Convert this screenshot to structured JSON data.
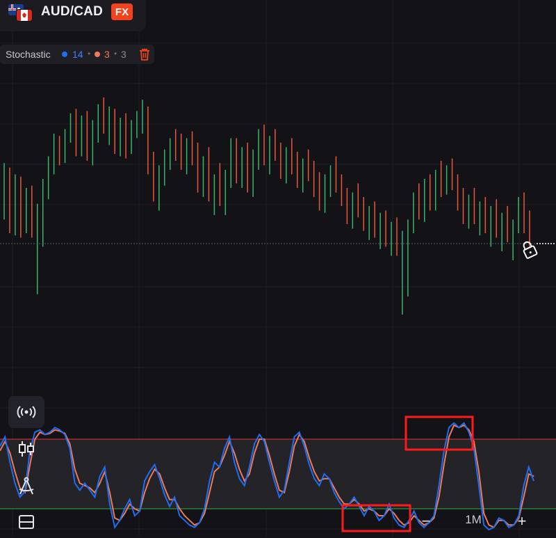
{
  "header": {
    "pair": "AUD/CAD",
    "badge": "FX"
  },
  "indicator": {
    "name": "Stochastic",
    "k_period": "14",
    "k_smoothing": "3",
    "d_period": "3",
    "k_color": "#1d6ef5",
    "d_color": "#f07a55"
  },
  "zoom": {
    "minus": "−",
    "level": "1M",
    "plus": "+"
  },
  "sidebar": {
    "icons": [
      "broadcast-icon",
      "candles-icon",
      "drawing-compass-icon",
      "layout-split-icon"
    ]
  },
  "colors": {
    "background": "#131317",
    "bull": "#3bb46c",
    "bear": "#e8573a",
    "overbought_line": "#e23a3a",
    "oversold_line": "#2bb24c",
    "highlight_box": "#ff1a1a"
  },
  "chart_data": {
    "type": "candlestick",
    "candles": [
      [
        0.52,
        0.71,
        0.46,
        0.63
      ],
      [
        0.63,
        0.69,
        0.4,
        0.46
      ],
      [
        0.46,
        0.66,
        0.39,
        0.6
      ],
      [
        0.6,
        0.65,
        0.38,
        0.49
      ],
      [
        0.49,
        0.6,
        0.4,
        0.55
      ],
      [
        0.55,
        0.61,
        0.38,
        0.41
      ],
      [
        0.41,
        0.53,
        0.13,
        0.48
      ],
      [
        0.48,
        0.64,
        0.34,
        0.58
      ],
      [
        0.58,
        0.74,
        0.55,
        0.72
      ],
      [
        0.72,
        0.84,
        0.66,
        0.8
      ],
      [
        0.8,
        0.83,
        0.7,
        0.74
      ],
      [
        0.74,
        0.86,
        0.71,
        0.83
      ],
      [
        0.83,
        0.93,
        0.8,
        0.9
      ],
      [
        0.9,
        0.95,
        0.74,
        0.77
      ],
      [
        0.77,
        0.92,
        0.74,
        0.89
      ],
      [
        0.89,
        0.94,
        0.72,
        0.76
      ],
      [
        0.76,
        0.9,
        0.7,
        0.86
      ],
      [
        0.86,
        0.97,
        0.8,
        0.94
      ],
      [
        0.94,
        1.0,
        0.84,
        0.87
      ],
      [
        0.87,
        0.96,
        0.79,
        0.92
      ],
      [
        0.92,
        0.95,
        0.75,
        0.8
      ],
      [
        0.8,
        0.91,
        0.74,
        0.88
      ],
      [
        0.88,
        0.93,
        0.73,
        0.78
      ],
      [
        0.78,
        0.9,
        0.75,
        0.86
      ],
      [
        0.86,
        0.94,
        0.82,
        0.9
      ],
      [
        0.9,
        0.99,
        0.84,
        0.93
      ],
      [
        0.93,
        0.96,
        0.66,
        0.69
      ],
      [
        0.69,
        0.76,
        0.54,
        0.58
      ],
      [
        0.58,
        0.7,
        0.5,
        0.66
      ],
      [
        0.66,
        0.77,
        0.61,
        0.73
      ],
      [
        0.73,
        0.82,
        0.68,
        0.79
      ],
      [
        0.79,
        0.86,
        0.72,
        0.76
      ],
      [
        0.76,
        0.84,
        0.68,
        0.7
      ],
      [
        0.7,
        0.82,
        0.66,
        0.78
      ],
      [
        0.78,
        0.85,
        0.7,
        0.74
      ],
      [
        0.74,
        0.8,
        0.58,
        0.62
      ],
      [
        0.62,
        0.74,
        0.56,
        0.7
      ],
      [
        0.7,
        0.78,
        0.54,
        0.58
      ],
      [
        0.58,
        0.66,
        0.48,
        0.62
      ],
      [
        0.62,
        0.71,
        0.52,
        0.55
      ],
      [
        0.55,
        0.68,
        0.48,
        0.64
      ],
      [
        0.64,
        0.82,
        0.6,
        0.79
      ],
      [
        0.79,
        0.82,
        0.62,
        0.66
      ],
      [
        0.66,
        0.78,
        0.6,
        0.74
      ],
      [
        0.74,
        0.8,
        0.58,
        0.62
      ],
      [
        0.62,
        0.77,
        0.56,
        0.72
      ],
      [
        0.72,
        0.86,
        0.68,
        0.82
      ],
      [
        0.82,
        0.88,
        0.7,
        0.74
      ],
      [
        0.74,
        0.83,
        0.66,
        0.79
      ],
      [
        0.79,
        0.86,
        0.72,
        0.76
      ],
      [
        0.76,
        0.8,
        0.64,
        0.68
      ],
      [
        0.68,
        0.78,
        0.62,
        0.74
      ],
      [
        0.74,
        0.82,
        0.66,
        0.7
      ],
      [
        0.7,
        0.76,
        0.6,
        0.64
      ],
      [
        0.64,
        0.73,
        0.58,
        0.7
      ],
      [
        0.7,
        0.77,
        0.63,
        0.66
      ],
      [
        0.66,
        0.72,
        0.56,
        0.6
      ],
      [
        0.6,
        0.67,
        0.5,
        0.56
      ],
      [
        0.56,
        0.66,
        0.49,
        0.62
      ],
      [
        0.62,
        0.7,
        0.56,
        0.66
      ],
      [
        0.66,
        0.74,
        0.58,
        0.6
      ],
      [
        0.6,
        0.66,
        0.52,
        0.55
      ],
      [
        0.55,
        0.6,
        0.44,
        0.5
      ],
      [
        0.5,
        0.58,
        0.42,
        0.54
      ],
      [
        0.54,
        0.62,
        0.47,
        0.5
      ],
      [
        0.5,
        0.56,
        0.41,
        0.45
      ],
      [
        0.45,
        0.52,
        0.37,
        0.48
      ],
      [
        0.48,
        0.54,
        0.38,
        0.42
      ],
      [
        0.42,
        0.49,
        0.33,
        0.46
      ],
      [
        0.46,
        0.5,
        0.34,
        0.38
      ],
      [
        0.38,
        0.45,
        0.3,
        0.42
      ],
      [
        0.42,
        0.47,
        0.3,
        0.35
      ],
      [
        0.35,
        0.41,
        0.04,
        0.38
      ],
      [
        0.38,
        0.46,
        0.12,
        0.43
      ],
      [
        0.43,
        0.58,
        0.4,
        0.55
      ],
      [
        0.55,
        0.62,
        0.46,
        0.49
      ],
      [
        0.49,
        0.64,
        0.45,
        0.6
      ],
      [
        0.6,
        0.66,
        0.5,
        0.53
      ],
      [
        0.53,
        0.68,
        0.5,
        0.65
      ],
      [
        0.65,
        0.72,
        0.56,
        0.62
      ],
      [
        0.62,
        0.7,
        0.57,
        0.68
      ],
      [
        0.68,
        0.73,
        0.59,
        0.62
      ],
      [
        0.62,
        0.66,
        0.5,
        0.54
      ],
      [
        0.54,
        0.6,
        0.44,
        0.5
      ],
      [
        0.5,
        0.57,
        0.42,
        0.55
      ],
      [
        0.55,
        0.6,
        0.44,
        0.47
      ],
      [
        0.47,
        0.54,
        0.39,
        0.51
      ],
      [
        0.51,
        0.56,
        0.4,
        0.43
      ],
      [
        0.43,
        0.52,
        0.34,
        0.48
      ],
      [
        0.48,
        0.55,
        0.38,
        0.41
      ],
      [
        0.41,
        0.49,
        0.32,
        0.45
      ],
      [
        0.45,
        0.52,
        0.36,
        0.39
      ],
      [
        0.39,
        0.46,
        0.28,
        0.43
      ],
      [
        0.43,
        0.56,
        0.4,
        0.53
      ],
      [
        0.53,
        0.58,
        0.4,
        0.44
      ],
      [
        0.44,
        0.5,
        0.34,
        0.38
      ]
    ],
    "stochastic": {
      "k": [
        74,
        82,
        60,
        42,
        30,
        35,
        70,
        86,
        88,
        84,
        86,
        90,
        88,
        84,
        72,
        42,
        36,
        42,
        36,
        30,
        48,
        56,
        24,
        4,
        10,
        20,
        28,
        14,
        18,
        44,
        52,
        58,
        46,
        32,
        22,
        30,
        14,
        10,
        6,
        4,
        8,
        20,
        44,
        60,
        56,
        72,
        82,
        60,
        46,
        40,
        56,
        76,
        84,
        78,
        60,
        44,
        30,
        36,
        60,
        82,
        86,
        74,
        58,
        46,
        40,
        50,
        46,
        34,
        26,
        20,
        24,
        30,
        22,
        14,
        22,
        18,
        10,
        14,
        24,
        12,
        6,
        4,
        10,
        18,
        8,
        4,
        8,
        14,
        40,
        70,
        90,
        94,
        90,
        94,
        86,
        72,
        40,
        6,
        2,
        4,
        12,
        10,
        4,
        6,
        14,
        40,
        56,
        44
      ],
      "d": [
        70,
        78,
        68,
        52,
        38,
        34,
        58,
        80,
        86,
        84,
        85,
        88,
        87,
        85,
        76,
        54,
        42,
        40,
        38,
        34,
        42,
        52,
        34,
        12,
        10,
        16,
        24,
        20,
        18,
        34,
        46,
        54,
        50,
        38,
        28,
        28,
        20,
        14,
        10,
        6,
        8,
        16,
        34,
        52,
        56,
        66,
        78,
        68,
        54,
        44,
        50,
        68,
        80,
        80,
        66,
        50,
        36,
        34,
        52,
        74,
        84,
        78,
        64,
        52,
        44,
        46,
        46,
        38,
        30,
        24,
        24,
        28,
        24,
        18,
        20,
        18,
        14,
        14,
        20,
        16,
        10,
        6,
        8,
        14,
        10,
        6,
        8,
        12,
        30,
        58,
        82,
        92,
        90,
        92,
        88,
        78,
        52,
        16,
        6,
        4,
        10,
        10,
        6,
        6,
        12,
        30,
        50,
        48
      ],
      "overbought": 80,
      "oversold": 20
    }
  }
}
